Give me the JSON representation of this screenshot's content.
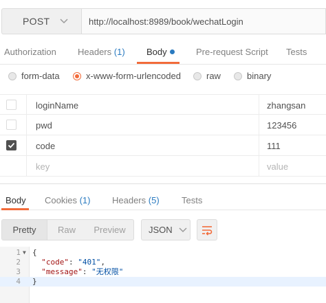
{
  "request": {
    "method": "POST",
    "url": "http://localhost:8989/book/wechatLogin"
  },
  "request_tabs": [
    {
      "label": "Authorization",
      "count": ""
    },
    {
      "label": "Headers",
      "count": "(1)"
    },
    {
      "label": "Body",
      "count": ""
    },
    {
      "label": "Pre-request Script",
      "count": ""
    },
    {
      "label": "Tests",
      "count": ""
    }
  ],
  "body_types": [
    {
      "label": "form-data",
      "selected": false
    },
    {
      "label": "x-www-form-urlencoded",
      "selected": true
    },
    {
      "label": "raw",
      "selected": false
    },
    {
      "label": "binary",
      "selected": false
    }
  ],
  "params": [
    {
      "key": "loginName",
      "value": "zhangsan",
      "checked": false
    },
    {
      "key": "pwd",
      "value": "123456",
      "checked": false
    },
    {
      "key": "code",
      "value": "111",
      "checked": true
    }
  ],
  "params_placeholder": {
    "key": "key",
    "value": "value"
  },
  "response_tabs": [
    {
      "label": "Body",
      "count": ""
    },
    {
      "label": "Cookies",
      "count": "(1)"
    },
    {
      "label": "Headers",
      "count": "(5)"
    },
    {
      "label": "Tests",
      "count": ""
    }
  ],
  "view_modes": [
    "Pretty",
    "Raw",
    "Preview"
  ],
  "format": "JSON",
  "code_lines": [
    {
      "num": "1",
      "text": "{"
    },
    {
      "num": "2",
      "key": "\"code\"",
      "val": "\"401\"",
      "tail": ","
    },
    {
      "num": "3",
      "key": "\"message\"",
      "val": "\"无权限\"",
      "tail": ""
    },
    {
      "num": "4",
      "text": "}"
    }
  ],
  "colors": {
    "accent": "#f26b3a",
    "link": "#2a7ac0"
  }
}
